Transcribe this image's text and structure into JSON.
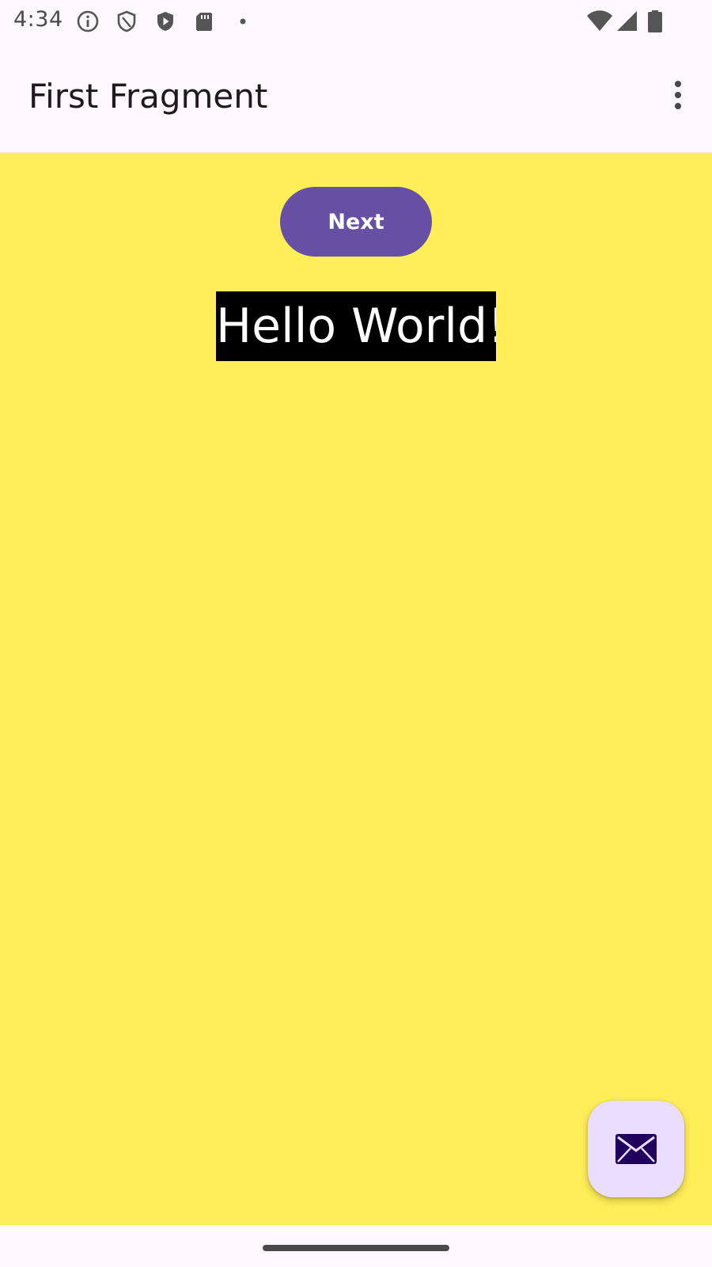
{
  "status_bar": {
    "time": "4:34",
    "icons": [
      "info-icon",
      "shield-outline-icon",
      "play-protect-icon",
      "sd-card-icon",
      "dot-icon",
      "wifi-icon",
      "signal-icon",
      "battery-icon"
    ]
  },
  "app_bar": {
    "title": "First Fragment",
    "menu_icon": "more-vert-icon"
  },
  "content": {
    "background_color": "#ffee58",
    "next_button_label": "Next",
    "next_button_color": "#6750a4",
    "hello_text": "Hello World!"
  },
  "fab": {
    "icon": "mail-icon",
    "color": "#eaddff"
  },
  "nav_bar": {
    "handle": "gesture-handle"
  }
}
